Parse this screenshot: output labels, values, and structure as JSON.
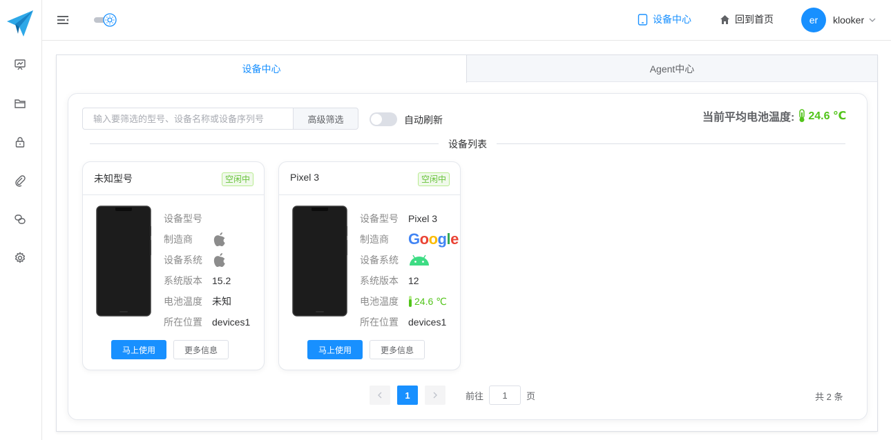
{
  "colors": {
    "accent": "#1890ff",
    "success": "#52c41a"
  },
  "header": {
    "nav": [
      {
        "label": "设备中心",
        "icon": "tablet-icon"
      },
      {
        "label": "回到首页",
        "icon": "home-icon"
      }
    ],
    "user": {
      "avatar_text": "er",
      "name": "klooker"
    }
  },
  "sidebar": {
    "items": [
      "presentation-icon",
      "folder-icon",
      "lock-icon",
      "paperclip-icon",
      "link-icon",
      "gear-icon"
    ]
  },
  "tabs": [
    {
      "label": "设备中心",
      "active": true
    },
    {
      "label": "Agent中心",
      "active": false
    }
  ],
  "toolbar": {
    "search_placeholder": "输入要筛选的型号、设备名称或设备序列号",
    "advanced_filter_label": "高级筛选",
    "auto_refresh_label": "自动刷新",
    "auto_refresh_on": false,
    "avg_temp_label": "当前平均电池温度:",
    "avg_temp_value": "24.6 ℃"
  },
  "list_title": "设备列表",
  "devices": [
    {
      "title": "未知型号",
      "status": "空闲中",
      "labels": [
        "设备型号",
        "制造商",
        "设备系统",
        "系统版本",
        "电池温度",
        "所在位置"
      ],
      "model": "",
      "manufacturer_icon": "apple-icon",
      "os_icon": "apple-icon",
      "os_version": "15.2",
      "battery_temp": "未知",
      "location": "devices1",
      "use_label": "马上使用",
      "more_label": "更多信息"
    },
    {
      "title": "Pixel 3",
      "status": "空闲中",
      "labels": [
        "设备型号",
        "制造商",
        "设备系统",
        "系统版本",
        "电池温度",
        "所在位置"
      ],
      "model": "Pixel 3",
      "manufacturer_icon": "google-logo",
      "manufacturer_logo_text": "Google",
      "os_icon": "android-icon",
      "os_version": "12",
      "battery_temp": "24.6 ℃",
      "location": "devices1",
      "use_label": "马上使用",
      "more_label": "更多信息"
    }
  ],
  "pagination": {
    "current_page": "1",
    "goto_label": "前往",
    "goto_value": "1",
    "goto_suffix": "页",
    "total_text": "共 2 条"
  }
}
